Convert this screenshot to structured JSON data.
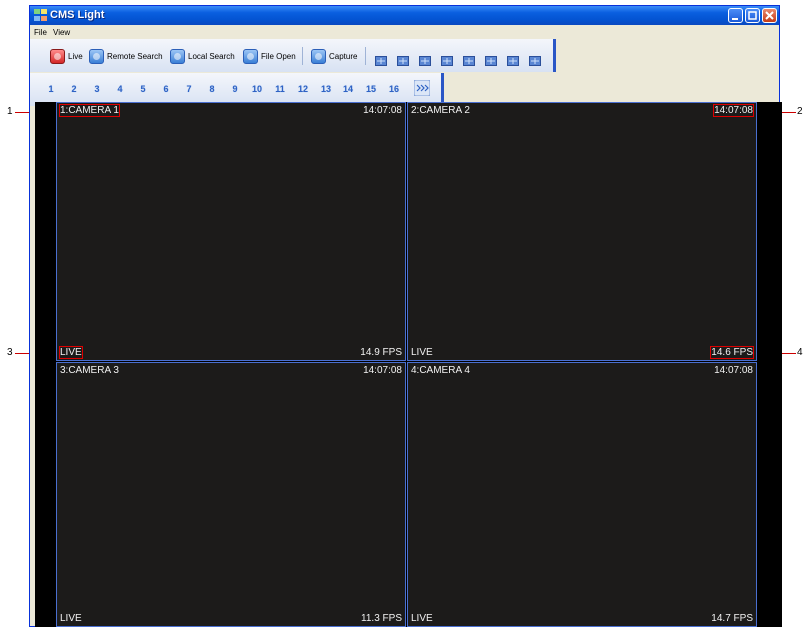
{
  "window": {
    "title": "CMS Light",
    "menu": [
      "File",
      "View"
    ]
  },
  "toolbar": {
    "buttons": [
      {
        "label": "Live",
        "icon": "live-icon"
      },
      {
        "label": "Remote Search",
        "icon": "remote-search-icon"
      },
      {
        "label": "Local Search",
        "icon": "local-search-icon"
      },
      {
        "label": "File Open",
        "icon": "file-open-icon"
      },
      {
        "label": "Capture",
        "icon": "capture-icon"
      }
    ],
    "layout_icons": [
      "layout-1-icon",
      "layout-4-icon",
      "layout-6-icon",
      "layout-8-icon",
      "layout-9-icon",
      "layout-10-icon",
      "layout-13-icon",
      "layout-16-icon"
    ]
  },
  "channels": [
    "1",
    "2",
    "3",
    "4",
    "5",
    "6",
    "7",
    "8",
    "9",
    "10",
    "11",
    "12",
    "13",
    "14",
    "15",
    "16"
  ],
  "channel_next_icon": "next-page-icon",
  "cameras": [
    {
      "name": "1:CAMERA 1",
      "time": "14:07:08",
      "mode": "LIVE",
      "fps": "14.9 FPS"
    },
    {
      "name": "2:CAMERA 2",
      "time": "14:07:08",
      "mode": "LIVE",
      "fps": "14.6 FPS"
    },
    {
      "name": "3:CAMERA 3",
      "time": "14:07:08",
      "mode": "LIVE",
      "fps": "11.3 FPS"
    },
    {
      "name": "4:CAMERA 4",
      "time": "14:07:08",
      "mode": "LIVE",
      "fps": "14.7 FPS"
    }
  ],
  "callouts": [
    "1",
    "2",
    "3",
    "4"
  ],
  "colors": {
    "title_bar": "#0a5fe0",
    "callout": "#cc0000",
    "pane_border": "#4a6fd0"
  }
}
